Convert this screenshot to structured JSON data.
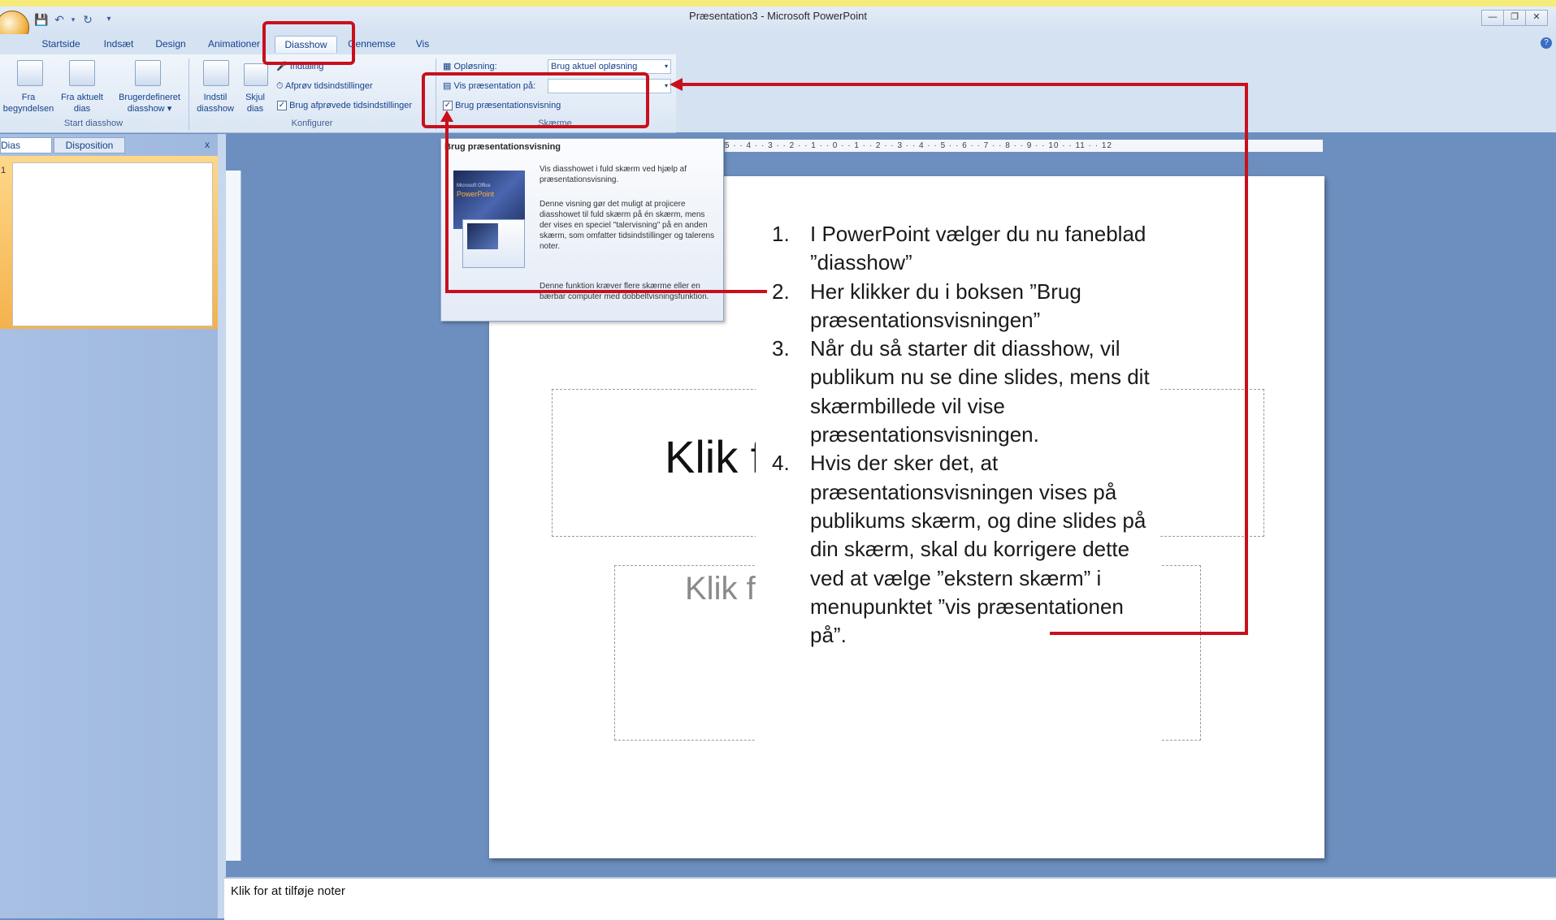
{
  "window": {
    "title": "Præsentation3 - Microsoft PowerPoint"
  },
  "quick_access": {
    "save_icon": "save-icon",
    "undo_icon": "undo-icon",
    "redo_icon": "redo-icon",
    "customize_icon": "customize-icon"
  },
  "tabs": [
    "Startside",
    "Indsæt",
    "Design",
    "Animationer",
    "Diasshow",
    "Gennemse",
    "Vis"
  ],
  "ribbon": {
    "start_group": {
      "label": "Start diasshow",
      "fra_begyndelsen_1": "Fra",
      "fra_begyndelsen_2": "begyndelsen",
      "fra_aktuelt_1": "Fra aktuelt",
      "fra_aktuelt_2": "dias",
      "brugerdefineret_1": "Brugerdefineret",
      "brugerdefineret_2": "diasshow"
    },
    "konfigurer_group": {
      "label": "Konfigurer",
      "indstil_1": "Indstil",
      "indstil_2": "diasshow",
      "skjul_1": "Skjul",
      "skjul_2": "dias",
      "indtaling": "Indtaling",
      "afproev": "Afprøv tidsindstillinger",
      "brug_afproevede": "Brug afprøvede tidsindstillinger"
    },
    "skaerme_group": {
      "label": "Skærme",
      "oploesning_label": "Opløsning:",
      "oploesning_value": "Brug aktuel opløsning",
      "vis_paa_label": "Vis præsentation på:",
      "vis_paa_value": "",
      "brug_praesentationsvisning": "Brug præsentationsvisning"
    }
  },
  "left_pane": {
    "tab_dias": "Dias",
    "tab_disposition": "Disposition",
    "close": "x",
    "slide_number": "1"
  },
  "ruler": {
    "horizontal": "5 · · 4 · · 3 · · 2 · · 1 · · 0 · · 1 · · 2 · · 3 · · 4 · · 5 · · 6 · · 7 · · 8 · · 9 · · 10 · · 11 · · 12"
  },
  "tooltip": {
    "title": "Brug præsentationsvisning",
    "p1": "Vis diasshowet i fuld skærm ved hjælp af præsentationsvisning.",
    "p2": "Denne visning gør det muligt at projicere diasshowet til fuld skærm på én skærm, mens der vises en speciel \"talervisning\" på en anden skærm, som omfatter tidsindstillinger og talerens noter.",
    "p3": "Denne funktion kræver flere skærme eller en bærbar computer med dobbeltvisningsfunktion.",
    "image_caption_1": "Microsoft Office",
    "image_caption_2": "PowerPoint"
  },
  "slide": {
    "title_placeholder": "Klik f",
    "subtitle_placeholder": "Klik f"
  },
  "instructions": [
    {
      "num": "1.",
      "text": "I PowerPoint vælger du nu faneblad ”diasshow”"
    },
    {
      "num": "2.",
      "text": "Her klikker du i boksen ”Brug præsentationsvisningen”"
    },
    {
      "num": "3.",
      "text": "Når du så starter dit diasshow, vil publikum nu se dine slides, mens dit skærmbillede vil vise præsentationsvisningen."
    },
    {
      "num": "4.",
      "text": "Hvis der sker det, at præsentationsvisningen vises på publikums skærm, og dine slides på din skærm, skal du korrigere dette ved at vælge ”ekstern skærm” i menupunktet ”vis præsentationen på”."
    }
  ],
  "notes": {
    "placeholder": "Klik for at tilføje noter"
  },
  "colors": {
    "annotation_red": "#c8101c",
    "ribbon_text": "#15428b",
    "background": "#6c8fbf"
  }
}
